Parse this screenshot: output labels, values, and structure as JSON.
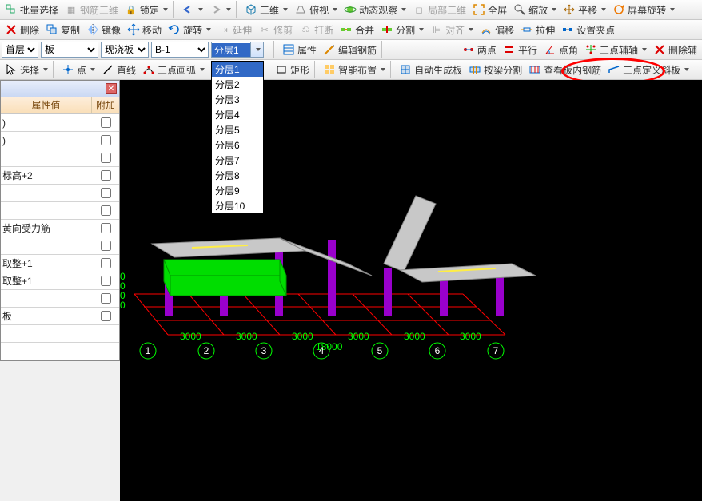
{
  "toolbar1": {
    "batch_select": "批量选择",
    "rebar_3d": "钢筋三维",
    "lock": "锁定",
    "view3d": "三维",
    "perspective": "俯视",
    "dynamic_observe": "动态观察",
    "local_3d": "局部三维",
    "fullscreen": "全屏",
    "zoom": "缩放",
    "pan": "平移",
    "screen_rotate": "屏幕旋转"
  },
  "toolbar2": {
    "delete": "删除",
    "copy": "复制",
    "mirror": "镜像",
    "move": "移动",
    "rotate": "旋转",
    "extend": "延伸",
    "trim": "修剪",
    "break": "打断",
    "merge": "合并",
    "split": "分割",
    "align": "对齐",
    "offset": "偏移",
    "stretch": "拉伸",
    "set_grip": "设置夹点"
  },
  "toolbar3": {
    "combo1": "首层",
    "combo2": "板",
    "combo3": "现浇板",
    "combo4": "B-1",
    "combo5_selected": "分层1",
    "combo5_items": [
      "分层1",
      "分层2",
      "分层3",
      "分层4",
      "分层5",
      "分层6",
      "分层7",
      "分层8",
      "分层9",
      "分层10"
    ],
    "attributes": "属性",
    "edit_rebar": "编辑钢筋",
    "two_point": "两点",
    "parallel": "平行",
    "point_angle": "点角",
    "three_point_aux": "三点辅轴",
    "delete_aux": "删除辅"
  },
  "toolbar4": {
    "select": "选择",
    "point": "点",
    "line": "直线",
    "arc3pt": "三点画弧",
    "rect": "矩形",
    "smart_layout": "智能布置",
    "auto_gen": "自动生成板",
    "split_by_beam": "按梁分割",
    "view_slab_rebar": "查看板内钢筋",
    "three_pt_slope": "三点定义斜板"
  },
  "panel": {
    "col_value": "属性值",
    "col_extra": "附加",
    "rows": [
      {
        "label": ")",
        "cb": true
      },
      {
        "label": ")",
        "cb": true
      },
      {
        "label": "",
        "cb": true
      },
      {
        "label": "标高+2",
        "cb": true
      },
      {
        "label": "",
        "cb": true
      },
      {
        "label": "",
        "cb": true
      },
      {
        "label": "黄向受力筋",
        "cb": true
      },
      {
        "label": "",
        "cb": true
      },
      {
        "label": "取整+1",
        "cb": true
      },
      {
        "label": "取整+1",
        "cb": true
      },
      {
        "label": "",
        "cb": true
      },
      {
        "label": "板",
        "cb": true
      },
      {
        "label": "",
        "cb": false
      },
      {
        "label": "",
        "cb": false
      }
    ]
  },
  "viewport": {
    "grid_labels": [
      "1",
      "2",
      "3",
      "4",
      "5",
      "6",
      "7"
    ],
    "dims": [
      "3000",
      "3000",
      "3000",
      "3000",
      "3000",
      "3000"
    ],
    "total": "18000",
    "vaxis": [
      "0",
      "0",
      "0",
      "0"
    ]
  }
}
